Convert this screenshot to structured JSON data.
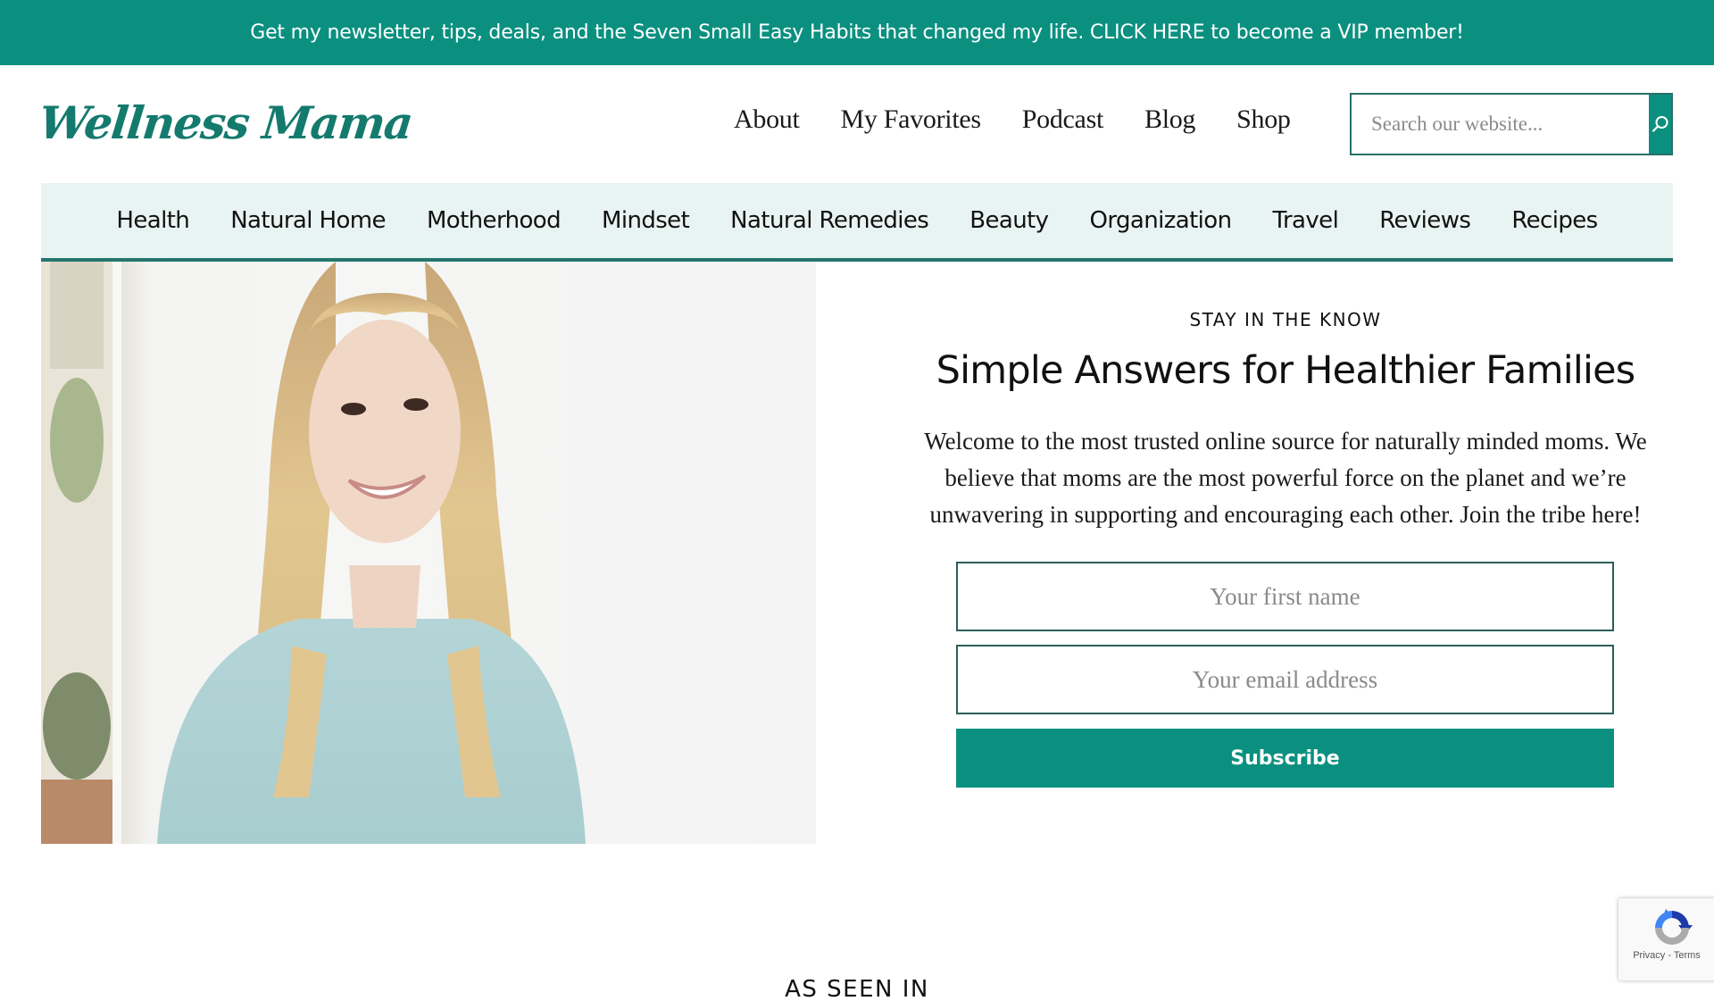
{
  "announcement": {
    "text": "Get my newsletter, tips, deals, and the Seven Small Easy Habits that changed my life. CLICK HERE to become a VIP member!"
  },
  "brand": {
    "logo_text": "Wellness Mama",
    "accent_color": "#0b9080",
    "logo_color": "#157a6e"
  },
  "main_nav": {
    "items": [
      {
        "label": "About"
      },
      {
        "label": "My Favorites"
      },
      {
        "label": "Podcast"
      },
      {
        "label": "Blog"
      },
      {
        "label": "Shop"
      }
    ]
  },
  "search": {
    "placeholder": "Search our website...",
    "value": "",
    "button_icon": "search-icon"
  },
  "category_nav": {
    "items": [
      {
        "label": "Health"
      },
      {
        "label": "Natural Home"
      },
      {
        "label": "Motherhood"
      },
      {
        "label": "Mindset"
      },
      {
        "label": "Natural Remedies"
      },
      {
        "label": "Beauty"
      },
      {
        "label": "Organization"
      },
      {
        "label": "Travel"
      },
      {
        "label": "Reviews"
      },
      {
        "label": "Recipes"
      }
    ]
  },
  "hero": {
    "image_alt": "Smiling woman with long blonde hair in a light blue sweater",
    "kicker": "STAY IN THE KNOW",
    "headline": "Simple Answers for Healthier Families",
    "intro": "Welcome to the most trusted online source for naturally minded moms. We believe that moms are the most powerful force on the planet and we’re unwavering in supporting and encouraging each other. Join the tribe here!",
    "form": {
      "first_name_placeholder": "Your first name",
      "first_name_value": "",
      "email_placeholder": "Your email address",
      "email_value": "",
      "submit_label": "Subscribe"
    }
  },
  "as_seen_in": {
    "heading": "AS SEEN IN"
  },
  "recaptcha": {
    "privacy_label": "Privacy",
    "separator": " - ",
    "terms_label": "Terms"
  }
}
